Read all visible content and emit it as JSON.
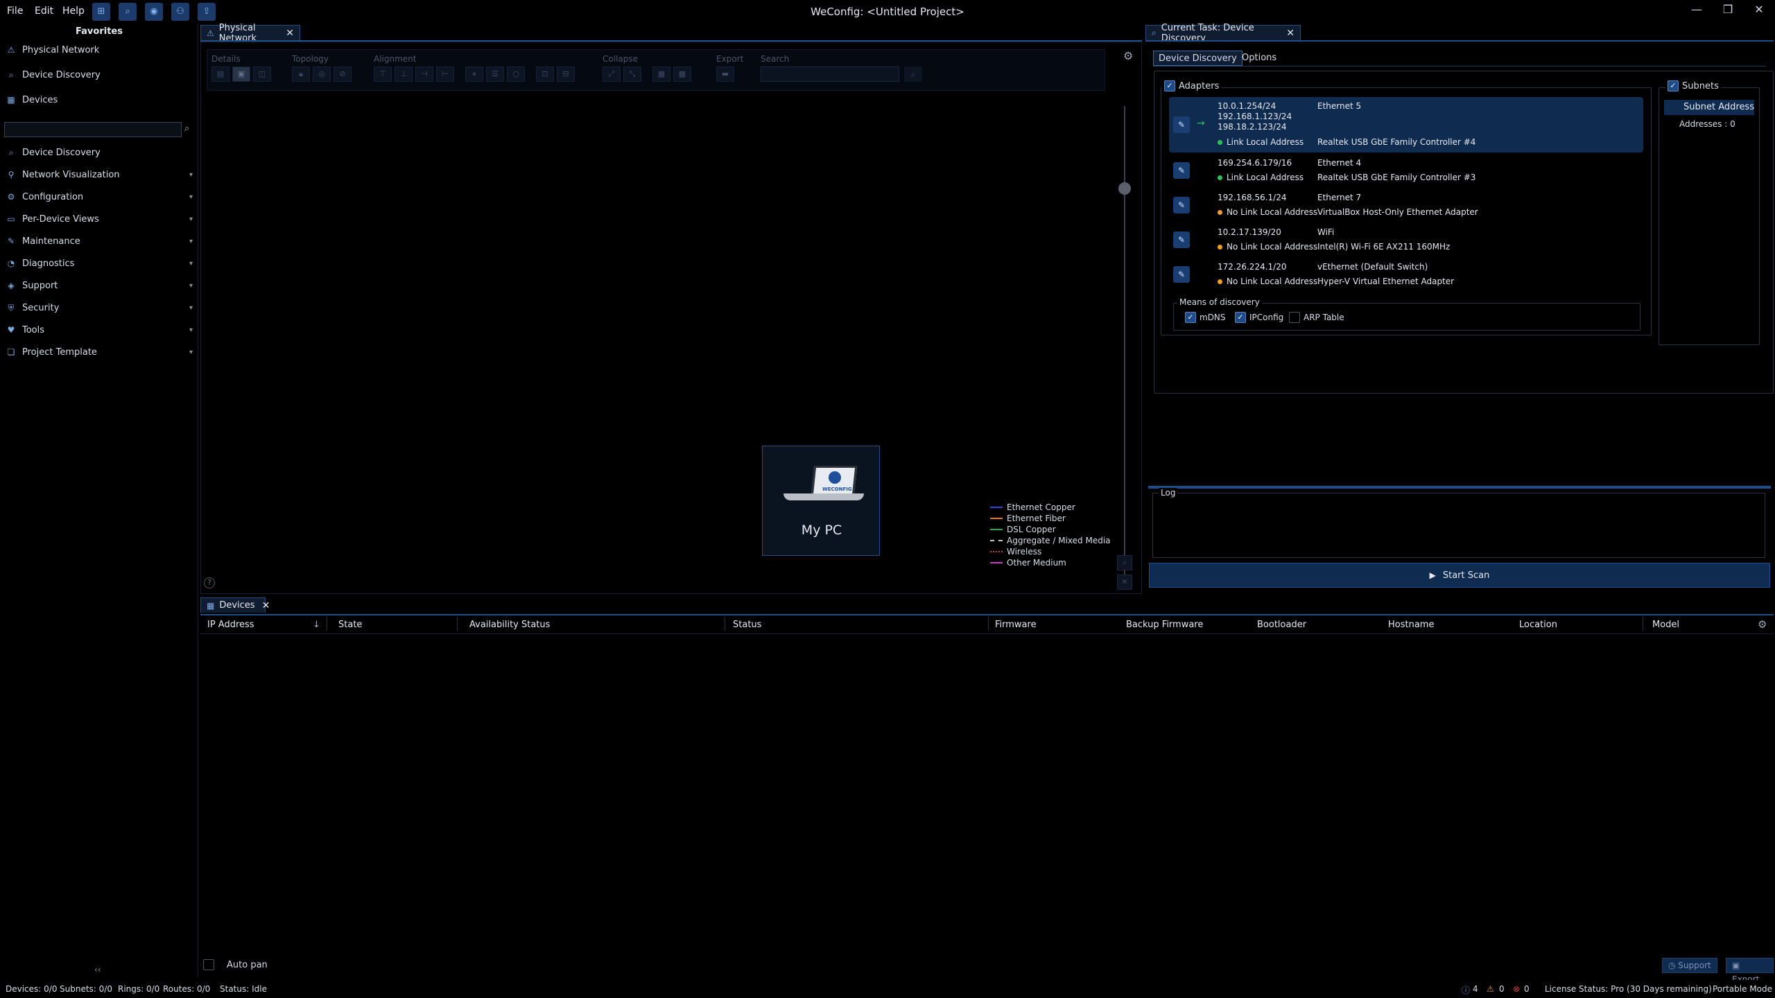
{
  "menu": {
    "file": "File",
    "edit": "Edit",
    "help": "Help"
  },
  "window": {
    "title": "WeConfig: <Untitled Project>"
  },
  "sidebar": {
    "favorites_title": "Favorites",
    "favorites": [
      "Physical Network",
      "Device Discovery",
      "Devices"
    ],
    "sections": [
      "Device Discovery",
      "Network Visualization",
      "Configuration",
      "Per-Device Views",
      "Maintenance",
      "Diagnostics",
      "Support",
      "Security",
      "Tools",
      "Project Template"
    ]
  },
  "tabs": {
    "physical_network": "Physical Network",
    "current_task": "Current Task: Device Discovery",
    "devices": "Devices"
  },
  "toolbar": {
    "details": "Details",
    "topology": "Topology",
    "alignment": "Alignment",
    "collapse": "Collapse",
    "export": "Export",
    "search": "Search"
  },
  "node": {
    "label": "My PC",
    "logo_text": "WECONFIG"
  },
  "legend": [
    {
      "label": "Ethernet Copper",
      "color": "#2b4bd8",
      "style": "solid"
    },
    {
      "label": "Ethernet Fiber",
      "color": "#e07a20",
      "style": "solid"
    },
    {
      "label": "DSL Copper",
      "color": "#2aa84a",
      "style": "solid"
    },
    {
      "label": "Aggregate / Mixed Media",
      "color": "#c8c8c8",
      "style": "dashed"
    },
    {
      "label": "Wireless",
      "color": "#c04060",
      "style": "dotted"
    },
    {
      "label": "Other Medium",
      "color": "#c040c0",
      "style": "solid"
    }
  ],
  "discovery": {
    "tab_discovery": "Device Discovery",
    "tab_options": "Options",
    "adapters_label": "Adapters",
    "subnets_label": "Subnets",
    "subnet_address": "Subnet Address",
    "addresses": "Addresses :  0",
    "adapters": [
      {
        "ips": [
          "10.0.1.254/24",
          "192.168.1.123/24",
          "198.18.2.123/24"
        ],
        "name": "Ethernet 5",
        "lla": "Link Local Address",
        "lla_color": "#2ec05a",
        "desc": "Realtek USB GbE Family Controller #4",
        "selected": true
      },
      {
        "ips": [
          "169.254.6.179/16"
        ],
        "name": "Ethernet 4",
        "lla": "Link Local Address",
        "lla_color": "#2ec05a",
        "desc": "Realtek USB GbE Family Controller #3",
        "selected": false
      },
      {
        "ips": [
          "192.168.56.1/24"
        ],
        "name": "Ethernet 7",
        "lla": "No Link Local Address",
        "lla_color": "#f0a020",
        "desc": "VirtualBox Host-Only Ethernet Adapter",
        "selected": false
      },
      {
        "ips": [
          "10.2.17.139/20"
        ],
        "name": "WiFi",
        "lla": "No Link Local Address",
        "lla_color": "#f0a020",
        "desc": "Intel(R) Wi-Fi 6E AX211 160MHz",
        "selected": false
      },
      {
        "ips": [
          "172.26.224.1/20"
        ],
        "name": "vEthernet (Default Switch)",
        "lla": "No Link Local Address",
        "lla_color": "#f0a020",
        "desc": "Hyper-V Virtual Ethernet Adapter",
        "selected": false
      }
    ],
    "means_label": "Means of discovery",
    "means": [
      {
        "label": "mDNS",
        "checked": true
      },
      {
        "label": "IPConfig",
        "checked": true
      },
      {
        "label": "ARP Table",
        "checked": false
      }
    ],
    "log_label": "Log",
    "start_scan": "Start Scan"
  },
  "devices_table": {
    "columns": [
      "IP Address",
      "State",
      "Availability Status",
      "Status",
      "Firmware",
      "Backup Firmware",
      "Bootloader",
      "Hostname",
      "Location",
      "Model"
    ],
    "auto_pan": "Auto pan",
    "support": "Support",
    "export": "Export"
  },
  "statusbar": {
    "devices": "Devices: 0/0",
    "subnets": "Subnets: 0/0",
    "rings": "Rings: 0/0",
    "routes": "Routes: 0/0",
    "status": "Status: Idle",
    "info_count": "4",
    "warn_count": "0",
    "err_count": "0",
    "license": "License Status: Pro (30 Days remaining)",
    "mode": "Portable Mode"
  }
}
